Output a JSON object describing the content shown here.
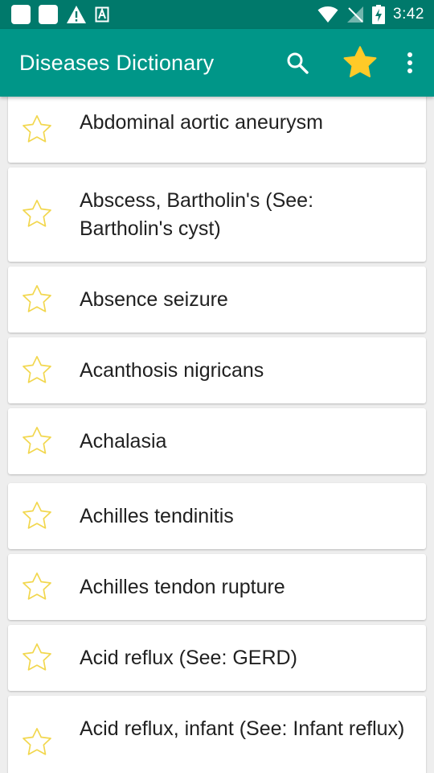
{
  "status_bar": {
    "time": "3:42",
    "left_icons": [
      "notification-square-icon",
      "notification-square-icon",
      "warning-icon",
      "app-notification-icon"
    ],
    "right_icons": [
      "wifi-icon",
      "no-signal-icon",
      "battery-charging-icon"
    ]
  },
  "app_bar": {
    "title": "Diseases Dictionary",
    "actions": [
      "search-icon",
      "favorites-star-icon",
      "overflow-menu-icon"
    ],
    "background": "#009688",
    "status_background": "#00796b",
    "favorite_star_color": "#FFCA28"
  },
  "list": {
    "item_star_outline_color": "#F2D74E",
    "items": [
      {
        "label": "Abdominal aortic aneurysm"
      },
      {
        "label": "Abscess, Bartholin's (See: Bartholin's cyst)"
      },
      {
        "label": "Absence seizure"
      },
      {
        "label": "Acanthosis nigricans"
      },
      {
        "label": "Achalasia"
      },
      {
        "label": "Achilles tendinitis"
      },
      {
        "label": "Achilles tendon rupture"
      },
      {
        "label": "Acid reflux (See: GERD)"
      },
      {
        "label": "Acid reflux, infant (See: Infant reflux)"
      }
    ]
  }
}
